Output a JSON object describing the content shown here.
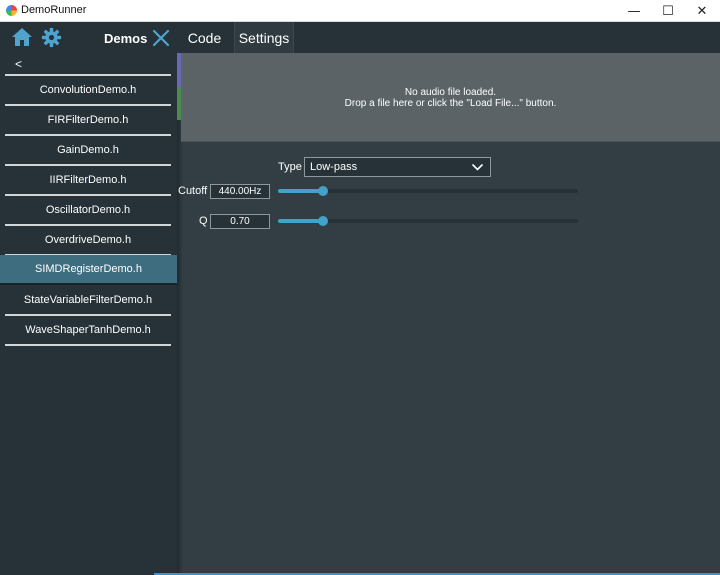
{
  "window": {
    "title": "DemoRunner",
    "minimize_glyph": "—",
    "maximize_glyph": "☐",
    "close_glyph": "✕"
  },
  "sidebar": {
    "header": {
      "label": "Demos",
      "home_icon": "home-icon",
      "settings_icon": "gear-icon",
      "close_icon": "close-icon"
    },
    "back_label": "<",
    "items": [
      {
        "label": "ConvolutionDemo.h",
        "selected": false
      },
      {
        "label": "FIRFilterDemo.h",
        "selected": false
      },
      {
        "label": "GainDemo.h",
        "selected": false
      },
      {
        "label": "IIRFilterDemo.h",
        "selected": false
      },
      {
        "label": "OscillatorDemo.h",
        "selected": false
      },
      {
        "label": "OverdriveDemo.h",
        "selected": false
      },
      {
        "label": "SIMDRegisterDemo.h",
        "selected": true
      },
      {
        "label": "StateVariableFilterDemo.h",
        "selected": false
      },
      {
        "label": "WaveShaperTanhDemo.h",
        "selected": false
      }
    ]
  },
  "tabs": [
    {
      "label": "Code"
    },
    {
      "label": "Settings"
    }
  ],
  "dropzone": {
    "line1": "No audio file loaded.",
    "line2": "Drop a file here or click the \"Load File...\" button."
  },
  "controls": {
    "type": {
      "label": "Type",
      "value": "Low-pass"
    },
    "cutoff": {
      "label": "Cutoff",
      "value": "440.00Hz",
      "slider_fraction": 0.15
    },
    "q": {
      "label": "Q",
      "value": "0.70",
      "slider_fraction": 0.15
    }
  },
  "colors": {
    "accent": "#42a2c8",
    "selected_item": "#3f6d80",
    "sidebar_bg": "#263238",
    "content_bg": "#323e44",
    "dropzone_bg": "#5b6367"
  }
}
